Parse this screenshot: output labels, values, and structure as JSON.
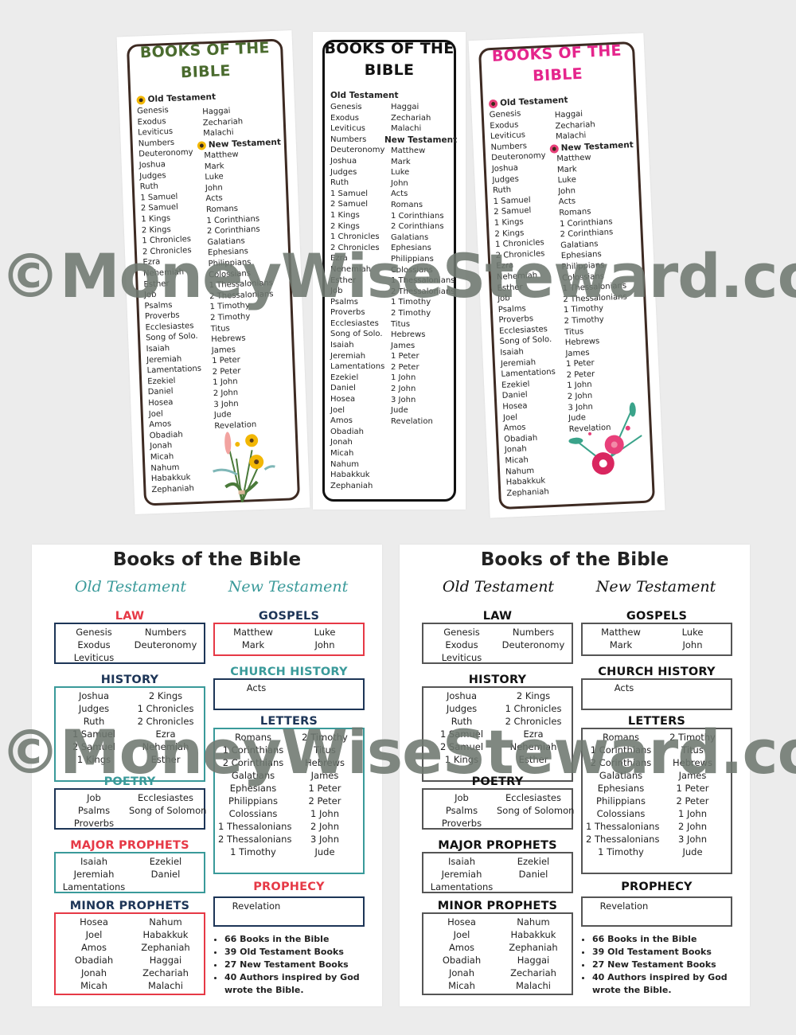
{
  "bookmarks": [
    {
      "variant": "green-sunflower",
      "title_line1": "BOOKS OF THE",
      "title_line2": "BIBLE",
      "title_color": "#4a6b2e",
      "accent_color": "#f2b705",
      "ot_heading": "Old Testament",
      "nt_heading": "New Testament",
      "ot_col1": [
        "Genesis",
        "Exodus",
        "Leviticus",
        "Numbers",
        "Deuteronomy",
        "Joshua",
        "Judges",
        "Ruth",
        "1 Samuel",
        "2 Samuel",
        "1 Kings",
        "2 Kings",
        "1 Chronicles",
        "2 Chronicles",
        "Ezra",
        "Nehemiah",
        "Esther",
        "Job",
        "Psalms",
        "Proverbs",
        "Ecclesiastes",
        "Song of Solo.",
        "Isaiah",
        "Jeremiah",
        "Lamentations",
        "Ezekiel",
        "Daniel",
        "Hosea",
        "Joel",
        "Amos",
        "Obadiah",
        "Jonah",
        "Micah",
        "Nahum",
        "Habakkuk",
        "Zephaniah"
      ],
      "ot_col2": [
        "Haggai",
        "Zechariah",
        "Malachi"
      ],
      "nt_col": [
        "Matthew",
        "Mark",
        "Luke",
        "John",
        "Acts",
        "Romans",
        "1 Corinthians",
        "2 Corinthians",
        "Galatians",
        "Ephesians",
        "Philippians",
        "Colossians",
        "1 Thessalonians",
        "2 Thessalonians",
        "1 Timothy",
        "2 Timothy",
        "Titus",
        "Hebrews",
        "James",
        "1 Peter",
        "2 Peter",
        "1 John",
        "2 John",
        "3 John",
        "Jude",
        "Revelation"
      ]
    },
    {
      "variant": "black-plain",
      "title_line1": "BOOKS OF THE",
      "title_line2": "BIBLE",
      "title_color": "#111111",
      "accent_color": "#111111",
      "ot_heading": "Old Testament",
      "nt_heading": "New Testament",
      "ot_col1": [
        "Genesis",
        "Exodus",
        "Leviticus",
        "Numbers",
        "Deuteronomy",
        "Joshua",
        "Judges",
        "Ruth",
        "1 Samuel",
        "2 Samuel",
        "1 Kings",
        "2 Kings",
        "1 Chronicles",
        "2 Chronicles",
        "Ezra",
        "Nehemiah",
        "Esther",
        "Job",
        "Psalms",
        "Proverbs",
        "Ecclesiastes",
        "Song of Solo.",
        "Isaiah",
        "Jeremiah",
        "Lamentations",
        "Ezekiel",
        "Daniel",
        "Hosea",
        "Joel",
        "Amos",
        "Obadiah",
        "Jonah",
        "Micah",
        "Nahum",
        "Habakkuk",
        "Zephaniah"
      ],
      "ot_col2": [
        "Haggai",
        "Zechariah",
        "Malachi"
      ],
      "nt_col": [
        "Matthew",
        "Mark",
        "Luke",
        "John",
        "Acts",
        "Romans",
        "1 Corinthians",
        "2 Corinthians",
        "Galatians",
        "Ephesians",
        "Philippians",
        "Colossians",
        "1 Thessalonians",
        "2 Thessalonians",
        "1 Timothy",
        "2 Timothy",
        "Titus",
        "Hebrews",
        "James",
        "1 Peter",
        "2 Peter",
        "1 John",
        "2 John",
        "3 John",
        "Jude",
        "Revelation"
      ]
    },
    {
      "variant": "pink-floral",
      "title_line1": "BOOKS OF THE",
      "title_line2": "BIBLE",
      "title_color": "#e5258c",
      "accent_color": "#e8407a",
      "ot_heading": "Old Testament",
      "nt_heading": "New Testament",
      "ot_col1": [
        "Genesis",
        "Exodus",
        "Leviticus",
        "Numbers",
        "Deuteronomy",
        "Joshua",
        "Judges",
        "Ruth",
        "1 Samuel",
        "2 Samuel",
        "1 Kings",
        "2 Kings",
        "1 Chronicles",
        "2 Chronicles",
        "Ezra",
        "Nehemiah",
        "Esther",
        "Job",
        "Psalms",
        "Proverbs",
        "Ecclesiastes",
        "Song of Solo.",
        "Isaiah",
        "Jeremiah",
        "Lamentations",
        "Ezekiel",
        "Daniel",
        "Hosea",
        "Joel",
        "Amos",
        "Obadiah",
        "Jonah",
        "Micah",
        "Nahum",
        "Habakkuk",
        "Zephaniah"
      ],
      "ot_col2": [
        "Haggai",
        "Zechariah",
        "Malachi"
      ],
      "nt_col": [
        "Matthew",
        "Mark",
        "Luke",
        "John",
        "Acts",
        "Romans",
        "1 Corinthians",
        "2 Corinthians",
        "Galatians",
        "Ephesians",
        "Philippians",
        "Colossians",
        "1 Thessalonians",
        "2 Thessalonians",
        "1 Timothy",
        "2 Timothy",
        "Titus",
        "Hebrews",
        "James",
        "1 Peter",
        "2 Peter",
        "1 John",
        "2 John",
        "3 John",
        "Jude",
        "Revelation"
      ]
    }
  ],
  "posters": [
    {
      "variant": "color",
      "title": "Books of the Bible",
      "ot_label": "Old Testament",
      "nt_label": "New Testament",
      "testament_color": "#3a9a9a",
      "sections": {
        "law": {
          "heading": "LAW",
          "head_color": "#e63946",
          "box_color": "#1d3557",
          "left": [
            "Genesis",
            "Exodus",
            "Leviticus"
          ],
          "right": [
            "Numbers",
            "Deuteronomy"
          ]
        },
        "history": {
          "heading": "HISTORY",
          "head_color": "#1d3557",
          "box_color": "#3a9a9a",
          "left": [
            "Joshua",
            "Judges",
            "Ruth",
            "1 Samuel",
            "2 Samuel",
            "1 Kings"
          ],
          "right": [
            "2 Kings",
            "1 Chronicles",
            "2 Chronicles",
            "Ezra",
            "Nehemiah",
            "Esther"
          ]
        },
        "poetry": {
          "heading": "POETRY",
          "head_color": "#3a9a9a",
          "box_color": "#1d3557",
          "left": [
            "Job",
            "Psalms",
            "Proverbs"
          ],
          "right": [
            "Ecclesiastes",
            "Song of Solomon"
          ]
        },
        "major_prophets": {
          "heading": "MAJOR PROPHETS",
          "head_color": "#e63946",
          "box_color": "#3a9a9a",
          "left": [
            "Isaiah",
            "Jeremiah",
            "Lamentations"
          ],
          "right": [
            "Ezekiel",
            "Daniel"
          ]
        },
        "minor_prophets": {
          "heading": "MINOR PROPHETS",
          "head_color": "#1d3557",
          "box_color": "#e63946",
          "left": [
            "Hosea",
            "Joel",
            "Amos",
            "Obadiah",
            "Jonah",
            "Micah"
          ],
          "right": [
            "Nahum",
            "Habakkuk",
            "Zephaniah",
            "Haggai",
            "Zechariah",
            "Malachi"
          ]
        },
        "gospels": {
          "heading": "GOSPELS",
          "head_color": "#1d3557",
          "box_color": "#e63946",
          "left": [
            "Matthew",
            "Mark"
          ],
          "right": [
            "Luke",
            "John"
          ]
        },
        "church_history": {
          "heading": "CHURCH HISTORY",
          "head_color": "#3a9a9a",
          "box_color": "#1d3557",
          "left": [
            "Acts"
          ],
          "right": []
        },
        "letters": {
          "heading": "LETTERS",
          "head_color": "#1d3557",
          "box_color": "#3a9a9a",
          "left": [
            "Romans",
            "1 Corinthians",
            "2 Corinthians",
            "Galatians",
            "Ephesians",
            "Philippians",
            "Colossians",
            "1 Thessalonians",
            "2 Thessalonians",
            "1 Timothy"
          ],
          "right": [
            "2 Timothy",
            "Titus",
            "Hebrews",
            "James",
            "1 Peter",
            "2 Peter",
            "1 John",
            "2 John",
            "3 John",
            "Jude"
          ]
        },
        "prophecy": {
          "heading": "PROPHECY",
          "head_color": "#e63946",
          "box_color": "#1d3557",
          "left": [
            "Revelation"
          ],
          "right": []
        }
      },
      "facts": [
        "66 Books in the Bible",
        "39 Old Testament Books",
        "27 New Testament Books",
        "40 Authors inspired by God wrote the Bible."
      ]
    },
    {
      "variant": "black-white",
      "title": "Books of the Bible",
      "ot_label": "Old Testament",
      "nt_label": "New Testament",
      "testament_color": "#111111",
      "sections": {
        "law": {
          "heading": "LAW",
          "head_color": "#111111",
          "box_color": "#555555",
          "left": [
            "Genesis",
            "Exodus",
            "Leviticus"
          ],
          "right": [
            "Numbers",
            "Deuteronomy"
          ]
        },
        "history": {
          "heading": "HISTORY",
          "head_color": "#111111",
          "box_color": "#555555",
          "left": [
            "Joshua",
            "Judges",
            "Ruth",
            "1 Samuel",
            "2 Samuel",
            "1 Kings"
          ],
          "right": [
            "2 Kings",
            "1 Chronicles",
            "2 Chronicles",
            "Ezra",
            "Nehemiah",
            "Esther"
          ]
        },
        "poetry": {
          "heading": "POETRY",
          "head_color": "#111111",
          "box_color": "#555555",
          "left": [
            "Job",
            "Psalms",
            "Proverbs"
          ],
          "right": [
            "Ecclesiastes",
            "Song of Solomon"
          ]
        },
        "major_prophets": {
          "heading": "MAJOR PROPHETS",
          "head_color": "#111111",
          "box_color": "#555555",
          "left": [
            "Isaiah",
            "Jeremiah",
            "Lamentations"
          ],
          "right": [
            "Ezekiel",
            "Daniel"
          ]
        },
        "minor_prophets": {
          "heading": "MINOR PROPHETS",
          "head_color": "#111111",
          "box_color": "#555555",
          "left": [
            "Hosea",
            "Joel",
            "Amos",
            "Obadiah",
            "Jonah",
            "Micah"
          ],
          "right": [
            "Nahum",
            "Habakkuk",
            "Zephaniah",
            "Haggai",
            "Zechariah",
            "Malachi"
          ]
        },
        "gospels": {
          "heading": "GOSPELS",
          "head_color": "#111111",
          "box_color": "#555555",
          "left": [
            "Matthew",
            "Mark"
          ],
          "right": [
            "Luke",
            "John"
          ]
        },
        "church_history": {
          "heading": "CHURCH HISTORY",
          "head_color": "#111111",
          "box_color": "#555555",
          "left": [
            "Acts"
          ],
          "right": []
        },
        "letters": {
          "heading": "LETTERS",
          "head_color": "#111111",
          "box_color": "#555555",
          "left": [
            "Romans",
            "1 Corinthians",
            "2 Corinthians",
            "Galatians",
            "Ephesians",
            "Philippians",
            "Colossians",
            "1 Thessalonians",
            "2 Thessalonians",
            "1 Timothy"
          ],
          "right": [
            "2 Timothy",
            "Titus",
            "Hebrews",
            "James",
            "1 Peter",
            "2 Peter",
            "1 John",
            "2 John",
            "3 John",
            "Jude"
          ]
        },
        "prophecy": {
          "heading": "PROPHECY",
          "head_color": "#111111",
          "box_color": "#555555",
          "left": [
            "Revelation"
          ],
          "right": []
        }
      },
      "facts": [
        "66 Books in the Bible",
        "39 Old Testament Books",
        "27 New Testament Books",
        "40 Authors inspired by God wrote the Bible."
      ]
    }
  ],
  "watermark": {
    "text": "©MoneyWiseSteward.com",
    "color": "#6e7870"
  }
}
